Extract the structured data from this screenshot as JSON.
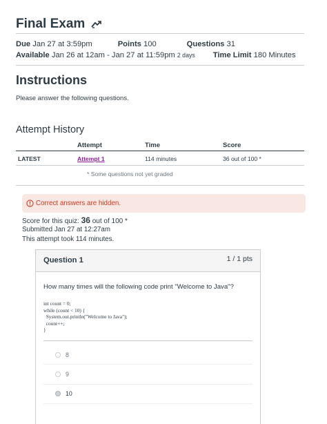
{
  "quiz": {
    "title": "Final Exam",
    "due_label": "Due",
    "due_value": "Jan 27 at 3:59pm",
    "points_label": "Points",
    "points_value": "100",
    "questions_label": "Questions",
    "questions_value": "31",
    "available_label": "Available",
    "available_value": "Jan 26 at 12am - Jan 27 at 11:59pm",
    "available_duration": "2 days",
    "time_limit_label": "Time Limit",
    "time_limit_value": "180 Minutes"
  },
  "instructions": {
    "heading": "Instructions",
    "text": "Please answer the following questions."
  },
  "attempt_history": {
    "heading": "Attempt History",
    "columns": [
      "",
      "Attempt",
      "Time",
      "Score"
    ],
    "rows": [
      {
        "label": "LATEST",
        "attempt": "Attempt 1",
        "time": "114 minutes",
        "score": "36 out of 100 *"
      }
    ],
    "note": "* Some questions not yet graded"
  },
  "alert": {
    "icon": "warning-circle-icon",
    "text": "Correct answers are hidden.",
    "color": "#cf3a1e"
  },
  "result": {
    "score_prefix": "Score for this quiz:",
    "score_value": "36",
    "score_suffix": "out of 100 *",
    "submitted": "Submitted Jan 27 at 12:27am",
    "took": "This attempt took 114 minutes."
  },
  "question": {
    "title": "Question 1",
    "points": "1 / 1 pts",
    "text": "How many times will the following code print \"Welcome to Java\"?",
    "code": "int count = 0;\nwhile (count < 10) {\n  System.out.println(\"Welcome to Java\");\n  count++;\n}",
    "options": [
      {
        "label": "8",
        "selected": false
      },
      {
        "label": "9",
        "selected": false
      },
      {
        "label": "10",
        "selected": true
      }
    ]
  }
}
